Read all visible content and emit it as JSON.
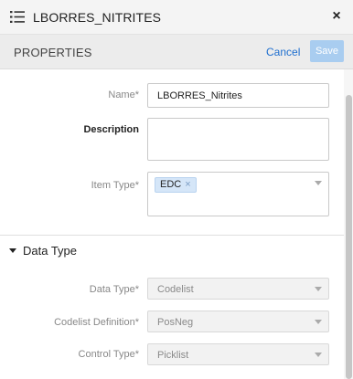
{
  "window": {
    "title": "LBORRES_NITRITES",
    "close_glyph": "×",
    "list_icon": "list-icon"
  },
  "header": {
    "title": "PROPERTIES",
    "cancel_label": "Cancel",
    "save_label": "Save"
  },
  "form": {
    "name": {
      "label": "Name*",
      "value": "LBORRES_Nitrites"
    },
    "description": {
      "label": "Description",
      "value": ""
    },
    "item_type": {
      "label": "Item Type*",
      "chips": [
        {
          "label": "EDC",
          "remove": "×"
        }
      ]
    }
  },
  "data_type_section": {
    "title": "Data Type",
    "data_type": {
      "label": "Data Type*",
      "value": "Codelist"
    },
    "codelist_definition": {
      "label": "Codelist Definition*",
      "value": "PosNeg"
    },
    "control_type": {
      "label": "Control Type*",
      "value": "Picklist"
    }
  },
  "colors": {
    "accent": "#1f6fcf",
    "save_disabled": "#a9cdf0",
    "chip_bg": "#d5e6f8"
  }
}
